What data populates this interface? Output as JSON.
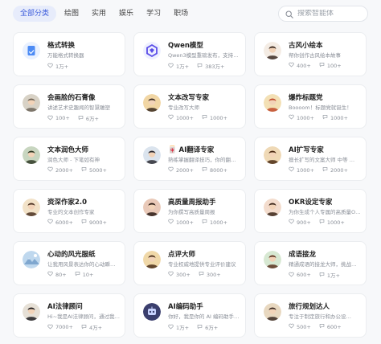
{
  "tabs": [
    {
      "label": "全部分类",
      "active": true
    },
    {
      "label": "绘图",
      "active": false
    },
    {
      "label": "实用",
      "active": false
    },
    {
      "label": "娱乐",
      "active": false
    },
    {
      "label": "学习",
      "active": false
    },
    {
      "label": "职场",
      "active": false
    }
  ],
  "search": {
    "placeholder": "搜索智能体",
    "icon": "search-icon"
  },
  "cards": [
    {
      "title": "格式转换",
      "desc": "万能格式转换器",
      "likes": "1万+",
      "uses": "",
      "avatar": {
        "type": "doc",
        "bg": "#e9f1ff",
        "fg": "#4c8bf5"
      }
    },
    {
      "title": "Qwen模型",
      "desc": "Qwen3模型重磅发布，支持多…",
      "likes": "1万+",
      "uses": "383万+",
      "avatar": {
        "type": "qwen",
        "bg": "#eef0ff",
        "fg": "#5b4ee8"
      }
    },
    {
      "title": "古风小绘本",
      "desc": "帮你创作古风绘本故事",
      "likes": "400+",
      "uses": "100+",
      "avatar": {
        "type": "portrait",
        "bg": "#f4ece4",
        "fg": "#3a2a22"
      }
    },
    {
      "title": "会画脸的石膏像",
      "desc": "讲述艺术史趣闻的智慧雕塑",
      "likes": "100+",
      "uses": "6万+",
      "avatar": {
        "type": "portrait",
        "bg": "#d8d2c6",
        "fg": "#6e665a"
      }
    },
    {
      "title": "文本改写专家",
      "desc": "专业改写大师",
      "likes": "1000+",
      "uses": "1000+",
      "avatar": {
        "type": "portrait",
        "bg": "#f1d6a4",
        "fg": "#3a2a1e"
      }
    },
    {
      "title": "爆炸标题党",
      "desc": "Boooom！标题党就诞生！",
      "likes": "1000+",
      "uses": "1000+",
      "avatar": {
        "type": "portrait",
        "bg": "#f3e0b5",
        "fg": "#c04a2a"
      }
    },
    {
      "title": "文本润色大师",
      "desc": "润色大师 - 下笔如有神",
      "likes": "2000+",
      "uses": "5000+",
      "avatar": {
        "type": "portrait",
        "bg": "#c8d6c0",
        "fg": "#2f3a26"
      }
    },
    {
      "title": "🀄 AI翻译专家",
      "desc": "熟练掌握翻译技巧，你的翻译…",
      "likes": "2000+",
      "uses": "8000+",
      "avatar": {
        "type": "portrait",
        "bg": "#dbe4ee",
        "fg": "#2b2b33"
      }
    },
    {
      "title": "AI扩写专家",
      "desc": "擅长扩写的文案大师 中等 …",
      "likes": "1000+",
      "uses": "2000+",
      "avatar": {
        "type": "portrait",
        "bg": "#efd9b6",
        "fg": "#4a2a12"
      }
    },
    {
      "title": "资深作家2.0",
      "desc": "专业的文本创作专家",
      "likes": "6000+",
      "uses": "9000+",
      "avatar": {
        "type": "portrait",
        "bg": "#f2e2c8",
        "fg": "#4a3020"
      }
    },
    {
      "title": "高质量周报助手",
      "desc": "为你撰写高质量周报",
      "likes": "1000+",
      "uses": "1000+",
      "avatar": {
        "type": "portrait",
        "bg": "#e9c9b8",
        "fg": "#2a1a14"
      }
    },
    {
      "title": "OKR设定专家",
      "desc": "为你生成个人专属的高质量OKR",
      "likes": "900+",
      "uses": "1000+",
      "avatar": {
        "type": "portrait",
        "bg": "#f3dccd",
        "fg": "#3a2418"
      }
    },
    {
      "title": "心动的风光服纸",
      "desc": "让我用风景表达你的心动瞬间…",
      "likes": "80+",
      "uses": "10+",
      "avatar": {
        "type": "landscape",
        "bg": "#bfd8ee",
        "fg": "#ffffff"
      }
    },
    {
      "title": "点评大师",
      "desc": "专业权威地提供专业评价建议",
      "likes": "300+",
      "uses": "300+",
      "avatar": {
        "type": "portrait",
        "bg": "#f0d8a8",
        "fg": "#4a2e18"
      }
    },
    {
      "title": "成语接龙",
      "desc": "精通成语的接龙大师，挑战你…",
      "likes": "600+",
      "uses": "1万+",
      "avatar": {
        "type": "portrait",
        "bg": "#d7e8d2",
        "fg": "#5a3220"
      }
    },
    {
      "title": "AI法律顾问",
      "desc": "Hi~我是AI法律顾问，通过我…",
      "likes": "7000+",
      "uses": "4万+",
      "avatar": {
        "type": "portrait",
        "bg": "#e6e0d6",
        "fg": "#1e1e22"
      }
    },
    {
      "title": "AI编码助手",
      "desc": "你好，我是你的 AI 编码助手…",
      "likes": "1万+",
      "uses": "6万+",
      "avatar": {
        "type": "robot",
        "bg": "#3b3f6e",
        "fg": "#c9d4ff"
      }
    },
    {
      "title": "旅行规划达人",
      "desc": "专注于制定旅行和办公设…",
      "likes": "500+",
      "uses": "600+",
      "avatar": {
        "type": "portrait",
        "bg": "#e8d8c0",
        "fg": "#3a2a22"
      }
    }
  ]
}
